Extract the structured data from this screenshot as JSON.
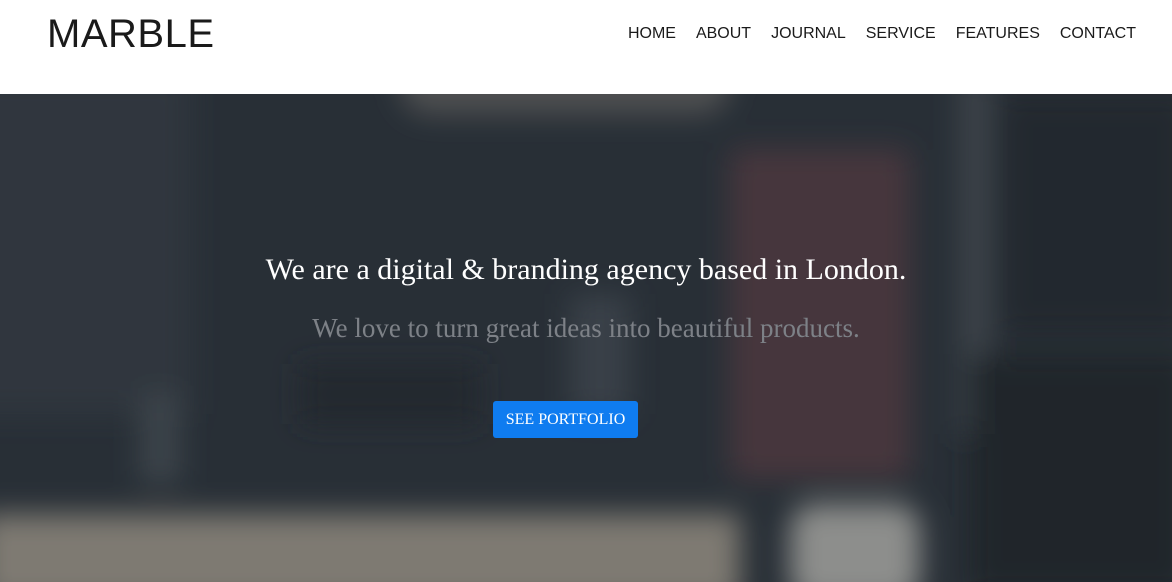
{
  "header": {
    "logo": "MARBLE",
    "nav": [
      "HOME",
      "ABOUT",
      "JOURNAL",
      "SERVICE",
      "FEATURES",
      "CONTACT"
    ]
  },
  "hero": {
    "headline": "We are a digital & branding agency based in London.",
    "subline": "We love to turn great ideas into beautiful products.",
    "cta_label": "SEE PORTFOLIO"
  },
  "colors": {
    "accent": "#0f7cf0",
    "hero_bg": "#2d333b",
    "header_bg": "#ffffff"
  }
}
